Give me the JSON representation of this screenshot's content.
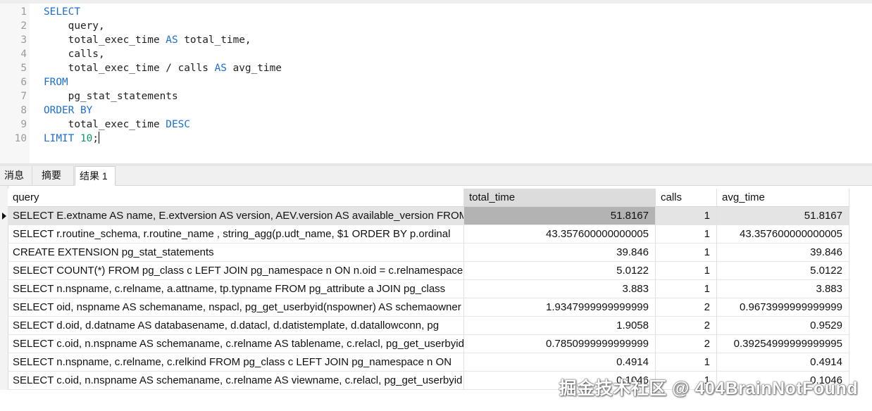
{
  "editor": {
    "lines": [
      {
        "n": "1",
        "tokens": [
          {
            "t": "SELECT",
            "c": "kw"
          }
        ]
      },
      {
        "n": "2",
        "tokens": [
          {
            "t": "    query,",
            "c": ""
          }
        ]
      },
      {
        "n": "3",
        "tokens": [
          {
            "t": "    total_exec_time ",
            "c": ""
          },
          {
            "t": "AS",
            "c": "kw"
          },
          {
            "t": " total_time,",
            "c": ""
          }
        ]
      },
      {
        "n": "4",
        "tokens": [
          {
            "t": "    calls,",
            "c": ""
          }
        ]
      },
      {
        "n": "5",
        "tokens": [
          {
            "t": "    total_exec_time / calls ",
            "c": ""
          },
          {
            "t": "AS",
            "c": "kw"
          },
          {
            "t": " avg_time",
            "c": ""
          }
        ]
      },
      {
        "n": "6",
        "tokens": [
          {
            "t": "FROM",
            "c": "kw"
          }
        ]
      },
      {
        "n": "7",
        "tokens": [
          {
            "t": "    pg_stat_statements",
            "c": ""
          }
        ]
      },
      {
        "n": "8",
        "tokens": [
          {
            "t": "ORDER BY",
            "c": "kw"
          }
        ]
      },
      {
        "n": "9",
        "tokens": [
          {
            "t": "    total_exec_time ",
            "c": ""
          },
          {
            "t": "DESC",
            "c": "kw"
          }
        ]
      },
      {
        "n": "10",
        "tokens": [
          {
            "t": "LIMIT",
            "c": "kw"
          },
          {
            "t": " ",
            "c": ""
          },
          {
            "t": "10",
            "c": "num"
          },
          {
            "t": ";",
            "c": ""
          }
        ]
      }
    ]
  },
  "tabs": [
    {
      "label": "消息",
      "active": false
    },
    {
      "label": "摘要",
      "active": false
    },
    {
      "label": "结果 1",
      "active": true
    }
  ],
  "grid": {
    "columns": [
      "query",
      "total_time",
      "calls",
      "avg_time"
    ],
    "sorted_column": "total_time",
    "selected_row": 0,
    "rows": [
      [
        "SELECT E.extname AS name, E.extversion AS version, AEV.version AS available_version FROM",
        "51.8167",
        "1",
        "51.8167"
      ],
      [
        "SELECT r.routine_schema, r.routine_name , string_agg(p.udt_name, $1 ORDER BY p.ordinal",
        "43.357600000000005",
        "1",
        "43.357600000000005"
      ],
      [
        "CREATE EXTENSION pg_stat_statements",
        "39.846",
        "1",
        "39.846"
      ],
      [
        "SELECT COUNT(*) FROM pg_class c LEFT JOIN pg_namespace n ON n.oid = c.relnamespace",
        "5.0122",
        "1",
        "5.0122"
      ],
      [
        "SELECT n.nspname, c.relname, a.attname, tp.typname FROM pg_attribute a JOIN pg_class",
        "3.883",
        "1",
        "3.883"
      ],
      [
        "SELECT oid, nspname AS schemaname, nspacl, pg_get_userbyid(nspowner) AS schemaowner",
        "1.9347999999999999",
        "2",
        "0.9673999999999999"
      ],
      [
        "SELECT d.oid, d.datname AS databasename, d.datacl, d.datistemplate, d.datallowconn, pg",
        "1.9058",
        "2",
        "0.9529"
      ],
      [
        "SELECT c.oid, n.nspname AS schemaname, c.relname AS tablename, c.relacl, pg_get_userbyid",
        "0.7850999999999999",
        "2",
        "0.39254999999999995"
      ],
      [
        "SELECT n.nspname, c.relname, c.relkind FROM pg_class c LEFT JOIN pg_namespace n ON",
        "0.4914",
        "1",
        "0.4914"
      ],
      [
        "SELECT c.oid, n.nspname AS schemaname, c.relname AS viewname, c.relacl, pg_get_userbyid",
        "0.1046",
        "1",
        "0.1046"
      ]
    ]
  },
  "watermark": "掘金技术社区 @ 404BrainNotFound"
}
